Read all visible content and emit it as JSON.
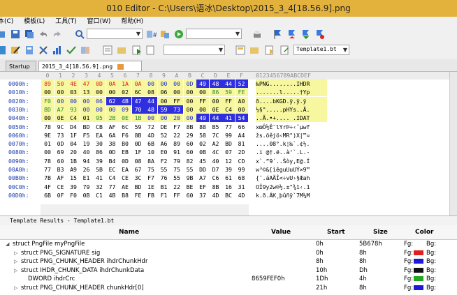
{
  "window": {
    "title": "010 Editor - C:\\Users\\语冰\\Desktop\\2015_3_4[18.56.9].png"
  },
  "menu": [
    "本(C)",
    "模板(L)",
    "工具(T)",
    "窗口(W)",
    "帮助(H)"
  ],
  "toolbar": {
    "template_combo_value": "Template1.bt"
  },
  "tabs": {
    "startup": "Startup",
    "file": "2015_3_4[18.56.9].png"
  },
  "hex_header": {
    "columns": [
      "0",
      "1",
      "2",
      "3",
      "4",
      "5",
      "6",
      "7",
      "8",
      "9",
      "A",
      "B",
      "C",
      "D",
      "E",
      "F"
    ],
    "ascii_ruler": "0123456789ABCDEF"
  },
  "hex_rows": [
    {
      "offset": "0000h:",
      "bytes": [
        "89",
        "50",
        "4E",
        "47",
        "0D",
        "0A",
        "1A",
        "0A",
        "00",
        "00",
        "00",
        "0D",
        "49",
        "48",
        "44",
        "52"
      ],
      "ascii": "‰PNG........IHDR"
    },
    {
      "offset": "0010h:",
      "bytes": [
        "00",
        "00",
        "03",
        "13",
        "00",
        "00",
        "02",
        "6C",
        "08",
        "06",
        "00",
        "00",
        "00",
        "86",
        "59",
        "FE"
      ],
      "ascii": ".......l.....†Yp"
    },
    {
      "offset": "0020h:",
      "bytes": [
        "F0",
        "00",
        "00",
        "00",
        "06",
        "62",
        "4B",
        "47",
        "44",
        "00",
        "FF",
        "00",
        "FF",
        "00",
        "FF",
        "A0"
      ],
      "ascii": "ð....bKGD.ÿ.ÿ.ÿ"
    },
    {
      "offset": "0030h:",
      "bytes": [
        "BD",
        "A7",
        "93",
        "00",
        "00",
        "00",
        "09",
        "70",
        "48",
        "59",
        "73",
        "00",
        "00",
        "0E",
        "C4",
        "00"
      ],
      "ascii": "½§\".....pHYs..Ä."
    },
    {
      "offset": "0040h:",
      "bytes": [
        "00",
        "0E",
        "C4",
        "01",
        "95",
        "2B",
        "0E",
        "1B",
        "00",
        "00",
        "20",
        "00",
        "49",
        "44",
        "41",
        "54"
      ],
      "ascii": "..Ä.•+.... .IDAT"
    },
    {
      "offset": "0050h:",
      "bytes": [
        "78",
        "9C",
        "D4",
        "BD",
        "CB",
        "AF",
        "6C",
        "59",
        "72",
        "DE",
        "F7",
        "8B",
        "88",
        "B5",
        "77",
        "66"
      ],
      "ascii": "xœÔ½Ë¯lYrÞ÷‹ˆµwf"
    },
    {
      "offset": "0060h:",
      "bytes": [
        "9E",
        "73",
        "1F",
        "F5",
        "EA",
        "6A",
        "F6",
        "8B",
        "4D",
        "52",
        "22",
        "29",
        "58",
        "7C",
        "99",
        "A4"
      ],
      "ascii": "žs.õêjö‹MR\")X|™¤"
    },
    {
      "offset": "0070h:",
      "bytes": [
        "01",
        "0D",
        "04",
        "19",
        "30",
        "38",
        "B0",
        "0D",
        "6B",
        "A6",
        "89",
        "60",
        "02",
        "A2",
        "BD",
        "81"
      ],
      "ascii": "....08°.k¦‰`.¢½."
    },
    {
      "offset": "0080h:",
      "bytes": [
        "00",
        "69",
        "20",
        "40",
        "86",
        "0D",
        "EB",
        "1F",
        "10",
        "E0",
        "91",
        "60",
        "0B",
        "4C",
        "07",
        "2D"
      ],
      "ascii": ".i @†.ë..à‘`.L.-"
    },
    {
      "offset": "0090h:",
      "bytes": [
        "78",
        "60",
        "1B",
        "94",
        "39",
        "B4",
        "0D",
        "08",
        "8A",
        "F2",
        "79",
        "82",
        "45",
        "40",
        "12",
        "CD"
      ],
      "ascii": "x`.”9´..Šòy‚E@.Í"
    },
    {
      "offset": "00A0h:",
      "bytes": [
        "77",
        "B3",
        "A9",
        "26",
        "5B",
        "EC",
        "EA",
        "67",
        "75",
        "55",
        "75",
        "55",
        "DD",
        "D7",
        "39",
        "99"
      ],
      "ascii": "w³©&[ìêguUuUÝ×9™"
    },
    {
      "offset": "00B0h:",
      "bytes": [
        "7B",
        "AF",
        "15",
        "E1",
        "41",
        "C4",
        "CE",
        "3C",
        "F7",
        "76",
        "55",
        "9B",
        "A7",
        "C6",
        "61",
        "68"
      ],
      "ascii": "{¯.áAÄÎ<÷vU›§Æah"
    },
    {
      "offset": "00C0h:",
      "bytes": [
        "4F",
        "CE",
        "39",
        "79",
        "32",
        "77",
        "AE",
        "BD",
        "1E",
        "B1",
        "22",
        "BE",
        "EF",
        "8B",
        "16",
        "31"
      ],
      "ascii": "OÎ9y2w®½.±\"¾ï‹.1"
    },
    {
      "offset": "00D0h:",
      "bytes": [
        "6B",
        "0F",
        "F0",
        "0B",
        "C1",
        "4B",
        "B8",
        "FE",
        "FB",
        "F1",
        "FF",
        "60",
        "37",
        "4D",
        "BC",
        "4D"
      ],
      "ascii": "k.ð.ÁK¸þûñÿ`7M¼M"
    }
  ],
  "template_bar": "Template Results - Template1.bt",
  "results": {
    "headers": {
      "name": "Name",
      "value": "Value",
      "start": "Start",
      "size": "Size",
      "color": "Color"
    },
    "rows": [
      {
        "name": "struct PngFile myPngFile",
        "value": "",
        "start": "0h",
        "size": "5B678h",
        "fg": "Fg:",
        "bg": "Bg:",
        "swatch": "",
        "expanded": true
      },
      {
        "name": "struct PNG_SIGNATURE sig",
        "value": "",
        "start": "0h",
        "size": "8h",
        "fg": "Fg:",
        "bg": "Bg:",
        "swatch": "#e02020"
      },
      {
        "name": "struct PNG_CHUNK_HEADER ihdrChunkHdr",
        "value": "",
        "start": "8h",
        "size": "8h",
        "fg": "Fg:",
        "bg": "Bg:",
        "swatch": "#1a1ad8"
      },
      {
        "name": "struct IHDR_CHUNK_DATA ihdrChunkData",
        "value": "",
        "start": "10h",
        "size": "Dh",
        "fg": "Fg:",
        "bg": "Bg:",
        "swatch": "#111111"
      },
      {
        "name": "DWORD ihdrCrc",
        "value": "8659FEF0h",
        "start": "1Dh",
        "size": "4h",
        "fg": "Fg:",
        "bg": "Bg:",
        "swatch": "#22a822"
      },
      {
        "name": "struct PNG_CHUNK_HEADER chunkHdr[0]",
        "value": "",
        "start": "21h",
        "size": "8h",
        "fg": "Fg:",
        "bg": "Bg:",
        "swatch": "#1a1ad8"
      }
    ]
  },
  "colors": {
    "title_bg": "#e3b23c",
    "selection": "#2f2fe0",
    "signature": "#d22222",
    "chunk_header": "#1a2ad8"
  }
}
